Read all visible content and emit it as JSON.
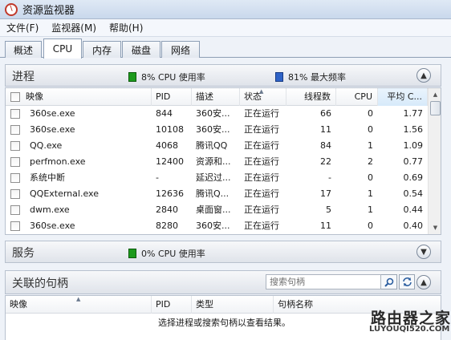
{
  "window": {
    "title": "资源监视器"
  },
  "menu": [
    "文件(F)",
    "监视器(M)",
    "帮助(H)"
  ],
  "tabs": [
    "概述",
    "CPU",
    "内存",
    "磁盘",
    "网络"
  ],
  "active_tab": "CPU",
  "processes": {
    "title": "进程",
    "cpu_usage": "8% CPU 使用率",
    "max_frequency": "81% 最大频率",
    "columns": [
      "映像",
      "PID",
      "描述",
      "状态",
      "线程数",
      "CPU",
      "平均 C..."
    ],
    "rows": [
      {
        "image": "360se.exe",
        "pid": "844",
        "desc": "360安...",
        "status": "正在运行",
        "threads": "66",
        "cpu": "0",
        "avg": "1.77"
      },
      {
        "image": "360se.exe",
        "pid": "10108",
        "desc": "360安...",
        "status": "正在运行",
        "threads": "11",
        "cpu": "0",
        "avg": "1.56"
      },
      {
        "image": "QQ.exe",
        "pid": "4068",
        "desc": "腾讯QQ",
        "status": "正在运行",
        "threads": "84",
        "cpu": "1",
        "avg": "1.09"
      },
      {
        "image": "perfmon.exe",
        "pid": "12400",
        "desc": "资源和...",
        "status": "正在运行",
        "threads": "22",
        "cpu": "2",
        "avg": "0.77"
      },
      {
        "image": "系统中断",
        "pid": "-",
        "desc": "延迟过...",
        "status": "正在运行",
        "threads": "-",
        "cpu": "0",
        "avg": "0.69"
      },
      {
        "image": "QQExternal.exe",
        "pid": "12636",
        "desc": "腾讯Q...",
        "status": "正在运行",
        "threads": "17",
        "cpu": "1",
        "avg": "0.54"
      },
      {
        "image": "dwm.exe",
        "pid": "2840",
        "desc": "桌面窗...",
        "status": "正在运行",
        "threads": "5",
        "cpu": "1",
        "avg": "0.44"
      },
      {
        "image": "360se.exe",
        "pid": "8280",
        "desc": "360安...",
        "status": "正在运行",
        "threads": "11",
        "cpu": "0",
        "avg": "0.40"
      }
    ]
  },
  "services": {
    "title": "服务",
    "cpu_usage": "0% CPU 使用率"
  },
  "handles": {
    "title": "关联的句柄",
    "search_placeholder": "搜索句柄",
    "columns": [
      "映像",
      "PID",
      "类型",
      "句柄名称"
    ],
    "empty_message": "选择进程或搜索句柄以查看结果。"
  },
  "watermark": {
    "brand": "路由器之家",
    "url": "LUYOUQI520.COM"
  },
  "colors": {
    "cpu_indicator": "#1d9a1d",
    "frequency_indicator": "#2f63c7"
  }
}
